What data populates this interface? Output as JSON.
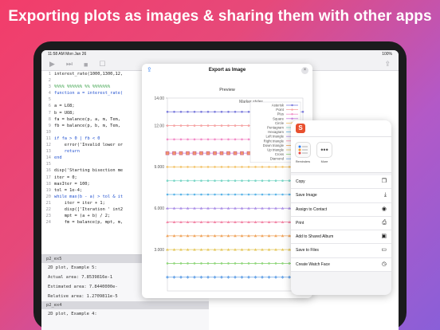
{
  "headline": "Exporting plots as images & sharing them with other apps",
  "status": {
    "time": "11:58 AM  Mon Jan 26",
    "battery": "100%"
  },
  "toolbar_icons": [
    "play-icon",
    "forward-icon",
    "stop-icon",
    "open-icon",
    "share-icon"
  ],
  "editor": {
    "lines": [
      {
        "n": "1",
        "t": "interest_rate(1000,1300,12,"
      },
      {
        "n": "2",
        "t": ""
      },
      {
        "n": "3",
        "t": "%%%% %%%%%% %% %%%%%%%"
      },
      {
        "n": "4",
        "t": "function a = interest_rate("
      },
      {
        "n": "5",
        "t": ""
      },
      {
        "n": "6",
        "t": "a = LO8;"
      },
      {
        "n": "7",
        "t": "b = UO8;"
      },
      {
        "n": "8",
        "t": "fa = balance(p, a, m, Tem,"
      },
      {
        "n": "9",
        "t": "fb = balance(p, b, m, Tem,"
      },
      {
        "n": "10",
        "t": ""
      },
      {
        "n": "11",
        "t": "if fa > 0 | fb < 0"
      },
      {
        "n": "12",
        "t": "    error('Invalid lower or"
      },
      {
        "n": "13",
        "t": "    return"
      },
      {
        "n": "14",
        "t": "end"
      },
      {
        "n": "15",
        "t": ""
      },
      {
        "n": "16",
        "t": "disp('Starting bisection me"
      },
      {
        "n": "17",
        "t": "iter = 0;"
      },
      {
        "n": "18",
        "t": "maxIter = 100;"
      },
      {
        "n": "19",
        "t": "tol = 1e-4;"
      },
      {
        "n": "20",
        "t": "while max(b - a) > tol & it"
      },
      {
        "n": "21",
        "t": "    iter = iter + 1;"
      },
      {
        "n": "22",
        "t": "    disp(['Iteration ' int2"
      },
      {
        "n": "23",
        "t": "    mpt = (a + b) / 2;"
      },
      {
        "n": "24",
        "t": "    fm = balance(p, mpt, m,"
      }
    ]
  },
  "console": {
    "header1": "p2_ex5",
    "lines1": [
      "2D plot, Example 5:",
      "Actual area: 7.8539816e-1",
      "Estimated area: 7.8440000e-",
      "Relative area: 1.2709811e-5"
    ],
    "header2": "p2_ex4",
    "lines2": [
      "2D plot, Example 4:"
    ]
  },
  "modal": {
    "title": "Export as Image",
    "preview_label": "Preview",
    "close_glyph": "×",
    "share_glyph": "⇪"
  },
  "chart_data": {
    "type": "line",
    "title": "Marker styles",
    "yticks": [
      "14.00",
      "12.00",
      "9.000",
      "6.000",
      "3.000"
    ],
    "ylim": [
      0,
      14
    ],
    "x": [
      0,
      1,
      2,
      3,
      4,
      5,
      6,
      7,
      8,
      9,
      10,
      11,
      12,
      13,
      14,
      15,
      16,
      17,
      18,
      19,
      20
    ],
    "series": [
      {
        "name": "Asterisk",
        "color": "#7b7bdc",
        "value": 13
      },
      {
        "name": "Point",
        "color": "#f5a3a3",
        "value": 12
      },
      {
        "name": "Plus",
        "color": "#f28ec9",
        "value": 11
      },
      {
        "name": "Square",
        "color": "#c87ae0",
        "value": 10
      },
      {
        "name": "Circle",
        "color": "#f3c46b",
        "value": 9
      },
      {
        "name": "Pentagram",
        "color": "#7bd6c7",
        "value": 8
      },
      {
        "name": "Hexagram",
        "color": "#5fb6e8",
        "value": 7
      },
      {
        "name": "Left triangle",
        "color": "#ab8ee6",
        "value": 6
      },
      {
        "name": "Right triangle",
        "color": "#f38aa9",
        "value": 5
      },
      {
        "name": "Down triangle",
        "color": "#f0a35a",
        "value": 4
      },
      {
        "name": "Up triangle",
        "color": "#e5c75a",
        "value": 3
      },
      {
        "name": "Cross",
        "color": "#8fd67a",
        "value": 2
      },
      {
        "name": "Diamond",
        "color": "#6fa8e8",
        "value": 1
      }
    ]
  },
  "sheet": {
    "app_icon_letter": "S",
    "apps": [
      {
        "label": "Reminders"
      },
      {
        "label": "More"
      }
    ],
    "actions": [
      {
        "label": "Copy",
        "icon": "copy-icon",
        "glyph": "❐"
      },
      {
        "label": "Save Image",
        "icon": "save-image-icon",
        "glyph": "⤓"
      },
      {
        "label": "Assign to Contact",
        "icon": "contact-icon",
        "glyph": "◉"
      },
      {
        "label": "Print",
        "icon": "print-icon",
        "glyph": "⎙"
      },
      {
        "label": "Add to Shared Album",
        "icon": "shared-album-icon",
        "glyph": "▣"
      },
      {
        "label": "Save to Files",
        "icon": "folder-icon",
        "glyph": "▭"
      },
      {
        "label": "Create Watch Face",
        "icon": "watch-icon",
        "glyph": "◷"
      }
    ]
  }
}
